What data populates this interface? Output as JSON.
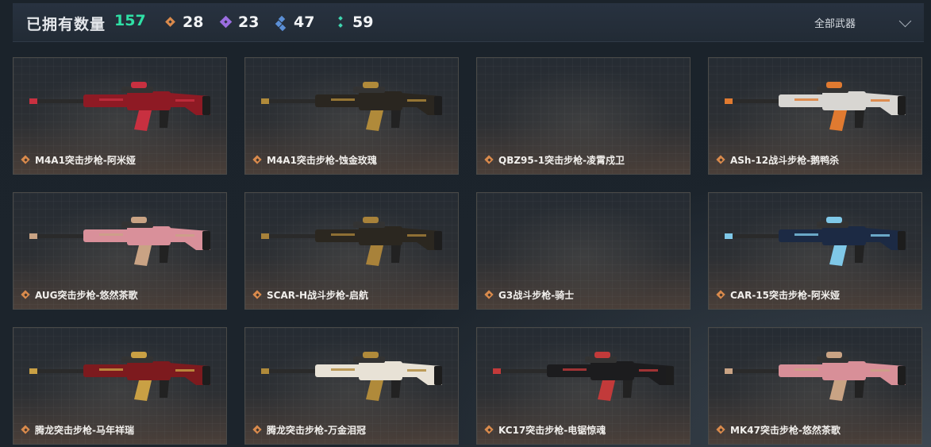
{
  "header": {
    "title": "已拥有数量",
    "total": "157",
    "stats": [
      {
        "icon": "orange-quality-icon",
        "value": "28",
        "color": "#d98a4c"
      },
      {
        "icon": "purple-quality-icon",
        "value": "23",
        "color": "#9b6ee0"
      },
      {
        "icon": "blue-quality-icon",
        "value": "47",
        "color": "#5b8fd6"
      },
      {
        "icon": "green-quality-icon",
        "value": "59",
        "color": "#3fd6b0"
      }
    ],
    "filter": {
      "selected": "全部武器",
      "icon": "chevron-down-icon"
    }
  },
  "weapons": [
    {
      "name": "M4A1突击步枪-阿米娅",
      "skin": "red",
      "body": "#8e1a24",
      "accent": "#c83040"
    },
    {
      "name": "M4A1突击步枪-蚀金玫瑰",
      "skin": "gold",
      "body": "#2a2620",
      "accent": "#b08a3a"
    },
    {
      "name": "QBZ95-1突击步枪-凌霄戍卫",
      "skin": "none",
      "body": "",
      "accent": ""
    },
    {
      "name": "ASh-12战斗步枪-鹅鸭杀",
      "skin": "white",
      "body": "#d8d6d2",
      "accent": "#e07a30"
    },
    {
      "name": "AUG突击步枪-悠然茶歌",
      "skin": "pink",
      "body": "#d9909a",
      "accent": "#c9a384"
    },
    {
      "name": "SCAR-H战斗步枪-启航",
      "skin": "gold",
      "body": "#2b2720",
      "accent": "#a8823a"
    },
    {
      "name": "G3战斗步枪-骑士",
      "skin": "none",
      "body": "",
      "accent": ""
    },
    {
      "name": "CAR-15突击步枪-阿米娅",
      "skin": "blue",
      "body": "#1c2a44",
      "accent": "#7fc8e8"
    },
    {
      "name": "腾龙突击步枪-马年祥瑞",
      "skin": "red",
      "body": "#7d1a1e",
      "accent": "#c9a044"
    },
    {
      "name": "腾龙突击步枪-万金泪冠",
      "skin": "white-gold",
      "body": "#e8e2d6",
      "accent": "#b08a3a"
    },
    {
      "name": "KC17突击步枪-电锯惊魂",
      "skin": "black",
      "body": "#1c1c1e",
      "accent": "#c23a3a"
    },
    {
      "name": "MK47突击步枪-悠然茶歌",
      "skin": "pink",
      "body": "#d88f98",
      "accent": "#c9a384"
    }
  ]
}
